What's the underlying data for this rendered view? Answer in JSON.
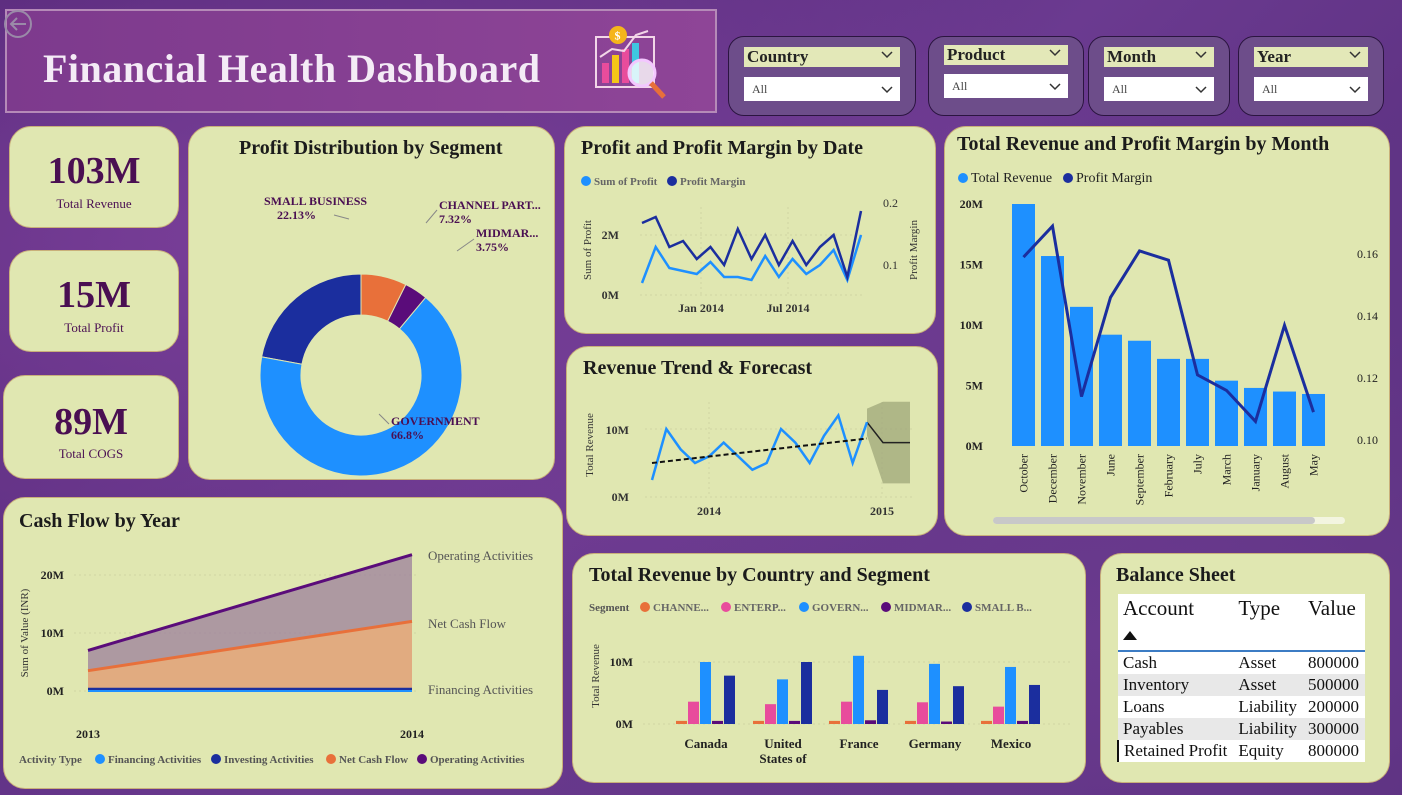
{
  "header": {
    "title": "Financial Health Dashboard"
  },
  "slicers": [
    {
      "label": "Country",
      "value": "All"
    },
    {
      "label": "Product",
      "value": "All"
    },
    {
      "label": "Month",
      "value": "All"
    },
    {
      "label": "Year",
      "value": "All"
    }
  ],
  "kpis": [
    {
      "value": "103M",
      "label": "Total Revenue"
    },
    {
      "value": "15M",
      "label": "Total Profit"
    },
    {
      "value": "89M",
      "label": "Total COGS"
    }
  ],
  "colors": {
    "light_blue": "#1e90ff",
    "dark_blue": "#1b2e9e",
    "orange": "#e8703a",
    "pink": "#e84c9c",
    "purple": "#5a0c7a",
    "card": "#e0e7b1"
  },
  "chart_data": [
    {
      "id": "profit_segment",
      "type": "pie",
      "title": "Profit Distribution by Segment",
      "slices": [
        {
          "label": "GOVERNMENT",
          "value": 66.8,
          "pct_label": "66.8%",
          "color": "#1e90ff"
        },
        {
          "label": "SMALL BUSINESS",
          "value": 22.13,
          "pct_label": "22.13%",
          "color": "#1b2e9e"
        },
        {
          "label": "CHANNEL PART...",
          "value": 7.32,
          "pct_label": "7.32%",
          "color": "#e8703a"
        },
        {
          "label": "MIDMAR...",
          "value": 3.75,
          "pct_label": "3.75%",
          "color": "#5a0c7a"
        }
      ]
    },
    {
      "id": "profit_by_date",
      "type": "line",
      "title": "Profit and Profit Margin by Date",
      "legend": [
        "Sum of Profit",
        "Profit Margin"
      ],
      "ylabel": "Sum of Profit",
      "y2label": "Profit Margin",
      "y_ticks": [
        "0M",
        "2M"
      ],
      "y2_ticks": [
        "0.1",
        "0.2"
      ],
      "x_ticks": [
        "Jan 2014",
        "Jul 2014"
      ],
      "series": [
        {
          "name": "Sum of Profit",
          "axis": "left",
          "values": [
            0.4,
            1.6,
            0.9,
            0.8,
            0.7,
            1.1,
            0.6,
            0.6,
            0.5,
            1.3,
            0.6,
            1.2,
            0.7,
            1.0,
            1.5,
            0.5,
            2.0
          ]
        },
        {
          "name": "Profit Margin",
          "axis": "right",
          "values": [
            0.17,
            0.18,
            0.13,
            0.14,
            0.11,
            0.13,
            0.1,
            0.16,
            0.11,
            0.15,
            0.1,
            0.14,
            0.1,
            0.13,
            0.15,
            0.08,
            0.19
          ]
        }
      ]
    },
    {
      "id": "revenue_trend",
      "type": "line",
      "title": "Revenue Trend & Forecast",
      "ylabel": "Total Revenue",
      "y_ticks": [
        "0M",
        "10M"
      ],
      "x_ticks": [
        "2014",
        "2015"
      ],
      "series": [
        {
          "name": "Total Revenue",
          "values": [
            2.5,
            10,
            7,
            5,
            6,
            8,
            6,
            4,
            5,
            10,
            8,
            5,
            9,
            12,
            5,
            11
          ]
        }
      ],
      "forecast": {
        "values": [
          11,
          8,
          8,
          8
        ],
        "upper": [
          13,
          14,
          14,
          14
        ],
        "lower": [
          9,
          2,
          2,
          2
        ]
      }
    },
    {
      "id": "revenue_by_month",
      "type": "bar",
      "title": "Total Revenue and Profit Margin by Month",
      "legend": [
        "Total Revenue",
        "Profit Margin"
      ],
      "categories": [
        "October",
        "December",
        "November",
        "June",
        "September",
        "February",
        "July",
        "March",
        "January",
        "August",
        "May"
      ],
      "series": [
        {
          "name": "Total Revenue",
          "values": [
            20,
            15.7,
            11.5,
            9.2,
            8.7,
            7.2,
            7.2,
            5.4,
            4.8,
            4.5,
            4.3
          ]
        },
        {
          "name": "Profit Margin",
          "values": [
            0.159,
            0.169,
            0.114,
            0.146,
            0.161,
            0.158,
            0.121,
            0.116,
            0.106,
            0.137,
            0.109
          ]
        }
      ],
      "y_ticks": [
        "0M",
        "5M",
        "10M",
        "15M",
        "20M"
      ],
      "y2_ticks": [
        "0.10",
        "0.12",
        "0.14",
        "0.16"
      ],
      "ylim": [
        0,
        20
      ],
      "y2lim": [
        0.1,
        0.17
      ]
    },
    {
      "id": "cash_flow",
      "type": "area",
      "title": "Cash Flow by Year",
      "ylabel": "Sum of Value (INR)",
      "x": [
        "2013",
        "2014"
      ],
      "y_ticks": [
        "0M",
        "10M",
        "20M"
      ],
      "legend_title": "Activity Type",
      "series": [
        {
          "name": "Financing Activities",
          "values": [
            0,
            0
          ],
          "color": "#1e90ff"
        },
        {
          "name": "Investing Activities",
          "values": [
            0.3,
            0.3
          ],
          "color": "#1b2e9e"
        },
        {
          "name": "Net Cash Flow",
          "values": [
            3.5,
            12
          ],
          "color": "#e8703a"
        },
        {
          "name": "Operating Activities",
          "values": [
            7,
            23.5
          ],
          "color": "#5a0c7a"
        }
      ],
      "labels": [
        "Operating Activities",
        "Net Cash Flow",
        "Financing Activities"
      ],
      "legend_labels": [
        "Financing Activities",
        "Investing Activities",
        "Net Cash Flow",
        "Operating Activities"
      ]
    },
    {
      "id": "revenue_country_segment",
      "type": "bar",
      "title": "Total Revenue by Country and Segment",
      "legend_title": "Segment",
      "legend": [
        "CHANNE...",
        "ENTERP...",
        "GOVERN...",
        "MIDMAR...",
        "SMALL B..."
      ],
      "ylabel": "Total Revenue",
      "y_ticks": [
        "0M",
        "10M"
      ],
      "categories": [
        "Canada",
        "United States of",
        "France",
        "Germany",
        "Mexico"
      ],
      "series": [
        {
          "name": "CHANNEL PARTNERS",
          "color": "#e8703a",
          "values": [
            0.5,
            0.5,
            0.5,
            0.5,
            0.5
          ]
        },
        {
          "name": "ENTERPRISE",
          "color": "#e84c9c",
          "values": [
            3.6,
            3.2,
            3.6,
            3.5,
            2.8
          ]
        },
        {
          "name": "GOVERNMENT",
          "color": "#1e90ff",
          "values": [
            10,
            7.2,
            11,
            9.7,
            9.2
          ]
        },
        {
          "name": "MIDMARKET",
          "color": "#5a0c7a",
          "values": [
            0.5,
            0.5,
            0.6,
            0.4,
            0.5
          ]
        },
        {
          "name": "SMALL BUSINESS",
          "color": "#1b2e9e",
          "values": [
            7.8,
            10,
            5.5,
            6.1,
            6.3
          ]
        }
      ]
    },
    {
      "id": "balance_sheet",
      "type": "table",
      "title": "Balance Sheet",
      "columns": [
        "Account",
        "Type",
        "Value"
      ],
      "rows": [
        [
          "Cash",
          "Asset",
          "800000"
        ],
        [
          "Inventory",
          "Asset",
          "500000"
        ],
        [
          "Loans",
          "Liability",
          "200000"
        ],
        [
          "Payables",
          "Liability",
          "300000"
        ],
        [
          "Retained Profit",
          "Equity",
          "800000"
        ]
      ]
    }
  ]
}
